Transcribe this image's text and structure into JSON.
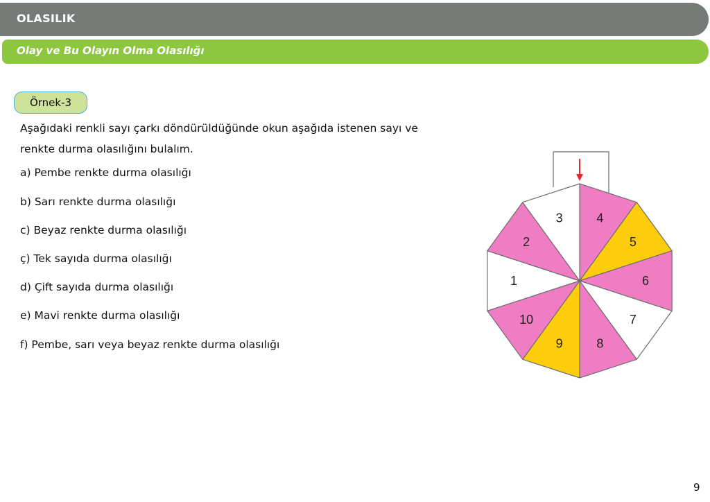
{
  "header": {
    "title": "OLASILIK"
  },
  "subheader": {
    "title": "Olay ve Bu Olayın Olma Olasılığı"
  },
  "example": {
    "badge": "Örnek-3",
    "intro_line1": "Aşağıdaki renkli sayı çarkı döndürüldüğünde okun aşağıda istenen sayı ve",
    "intro_line2": "renkte durma olasılığını bulalım.",
    "questions": [
      "a)  Pembe renkte durma olasılığı",
      "b)  Sarı renkte durma olasılığı",
      "c)  Beyaz renkte durma olasılığı",
      "ç) Tek sayıda durma olasılığı",
      "d)  Çift sayıda durma olasılığı",
      "e)  Mavi renkte durma olasılığı",
      "f)   Pembe, sarı veya beyaz renkte durma olasılığı"
    ]
  },
  "wheel": {
    "sectors": [
      {
        "number": "4",
        "color": "pink"
      },
      {
        "number": "5",
        "color": "yellow"
      },
      {
        "number": "6",
        "color": "pink"
      },
      {
        "number": "7",
        "color": "white"
      },
      {
        "number": "8",
        "color": "pink"
      },
      {
        "number": "9",
        "color": "yellow"
      },
      {
        "number": "10",
        "color": "pink"
      },
      {
        "number": "1",
        "color": "white"
      },
      {
        "number": "2",
        "color": "pink"
      },
      {
        "number": "3",
        "color": "white"
      }
    ],
    "colors": {
      "pink": "#f07cc4",
      "yellow": "#fdcc0c",
      "white": "#ffffff",
      "arrow": "#e8262b"
    }
  },
  "page": {
    "number": "9"
  }
}
